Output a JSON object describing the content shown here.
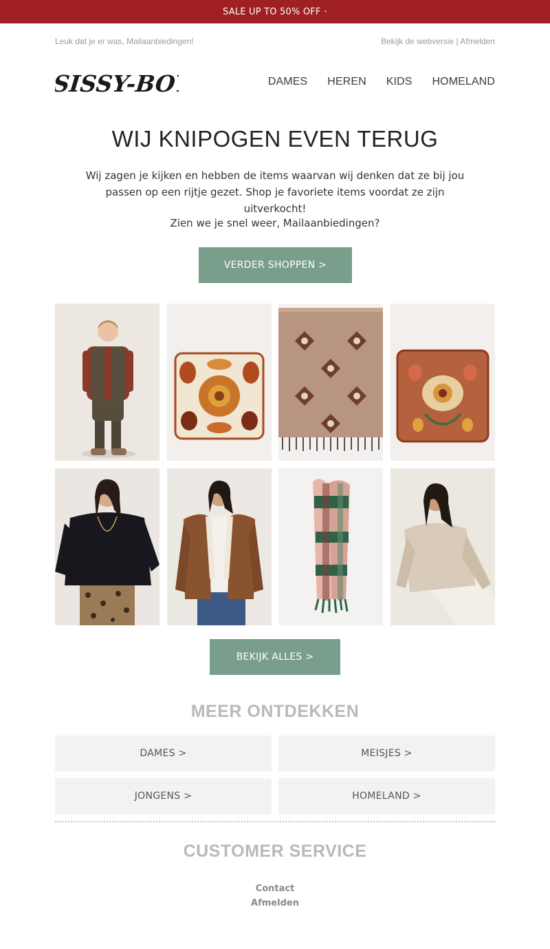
{
  "banner": {
    "text": "SALE UP TO 50% OFF",
    "arrow": "‣"
  },
  "preheader": {
    "greeting": "Leuk dat je er was, Mailaanbiedingen!",
    "webversion": "Bekijk de webversie",
    "separator": "|",
    "unsubscribe": "Afmelden"
  },
  "logo": {
    "text": "SISSY-BOY"
  },
  "nav": {
    "items": [
      "DAMES",
      "HEREN",
      "KIDS",
      "HOMELAND"
    ]
  },
  "headline": "WIJ KNIPOGEN EVEN TERUG",
  "intro": "Wij zagen je kijken en hebben de items waarvan wij denken dat ze bij jou passen op een rijtje gezet. Shop je favoriete items voordat ze zijn uitverkocht!",
  "greeting": "Zien we je snel weer, Mailaanbiedingen?",
  "cta_shop": "VERDER SHOPPEN >",
  "products": [
    {
      "icon": "kid-bodywarmer-photo"
    },
    {
      "icon": "floral-cushion-photo"
    },
    {
      "icon": "patterned-throw-photo"
    },
    {
      "icon": "embroidered-cushion-photo"
    },
    {
      "icon": "black-sweater-photo"
    },
    {
      "icon": "suede-jacket-photo"
    },
    {
      "icon": "checked-scarf-photo"
    },
    {
      "icon": "beige-knit-photo"
    }
  ],
  "cta_all": "BEKIJK ALLES >",
  "discover": {
    "title": "MEER ONTDEKKEN",
    "categories": [
      "DAMES >",
      "MEISJES >",
      "JONGENS >",
      "HOMELAND >"
    ]
  },
  "service": {
    "title": "CUSTOMER SERVICE",
    "contact": "Contact",
    "unsubscribe": "Afmelden"
  },
  "colors": {
    "banner": "#a01f23",
    "button": "#7a9e8c",
    "category_bg": "#f2f2f2"
  }
}
